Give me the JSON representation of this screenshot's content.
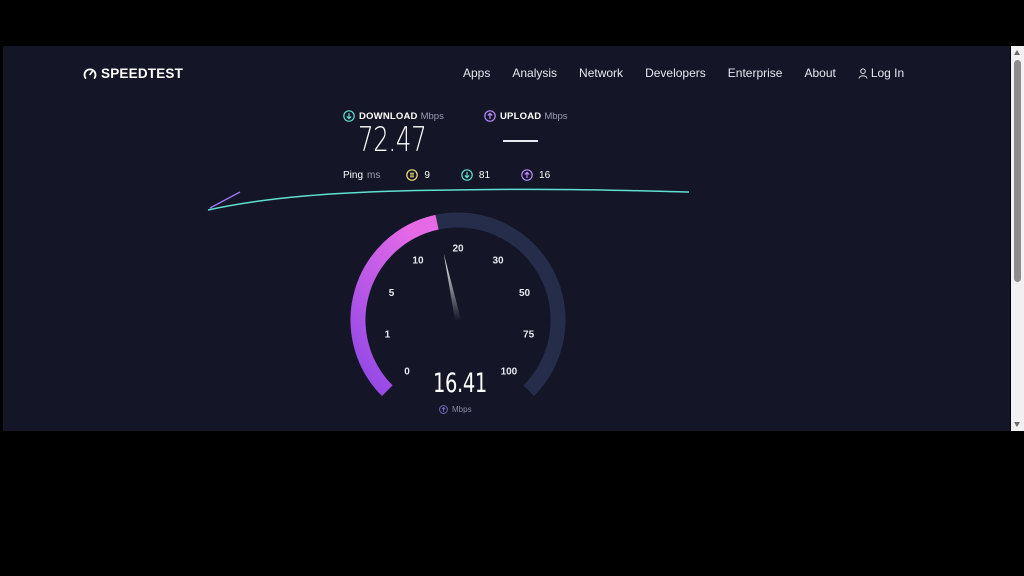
{
  "header": {
    "logo_text": "SPEEDTEST",
    "nav": [
      "Apps",
      "Analysis",
      "Network",
      "Developers",
      "Enterprise",
      "About"
    ],
    "login_label": "Log In"
  },
  "download": {
    "label": "DOWNLOAD",
    "unit": "Mbps",
    "value": "72.47",
    "color": "#5fe0d0"
  },
  "upload": {
    "label": "UPLOAD",
    "unit": "Mbps",
    "value": "—",
    "color": "#b88bff"
  },
  "ping": {
    "label": "Ping",
    "unit": "ms",
    "idle": "9",
    "download": "81",
    "upload": "16",
    "idle_color": "#f0e27a"
  },
  "gauge": {
    "current_value": "16.41",
    "current_unit": "Mbps",
    "current_mbps": 16.41,
    "ticks": [
      "0",
      "1",
      "5",
      "10",
      "20",
      "30",
      "50",
      "75",
      "100"
    ],
    "arc_color_start": "#8c46e6",
    "arc_color_end": "#e66ae6",
    "track_color": "#262d4b"
  }
}
